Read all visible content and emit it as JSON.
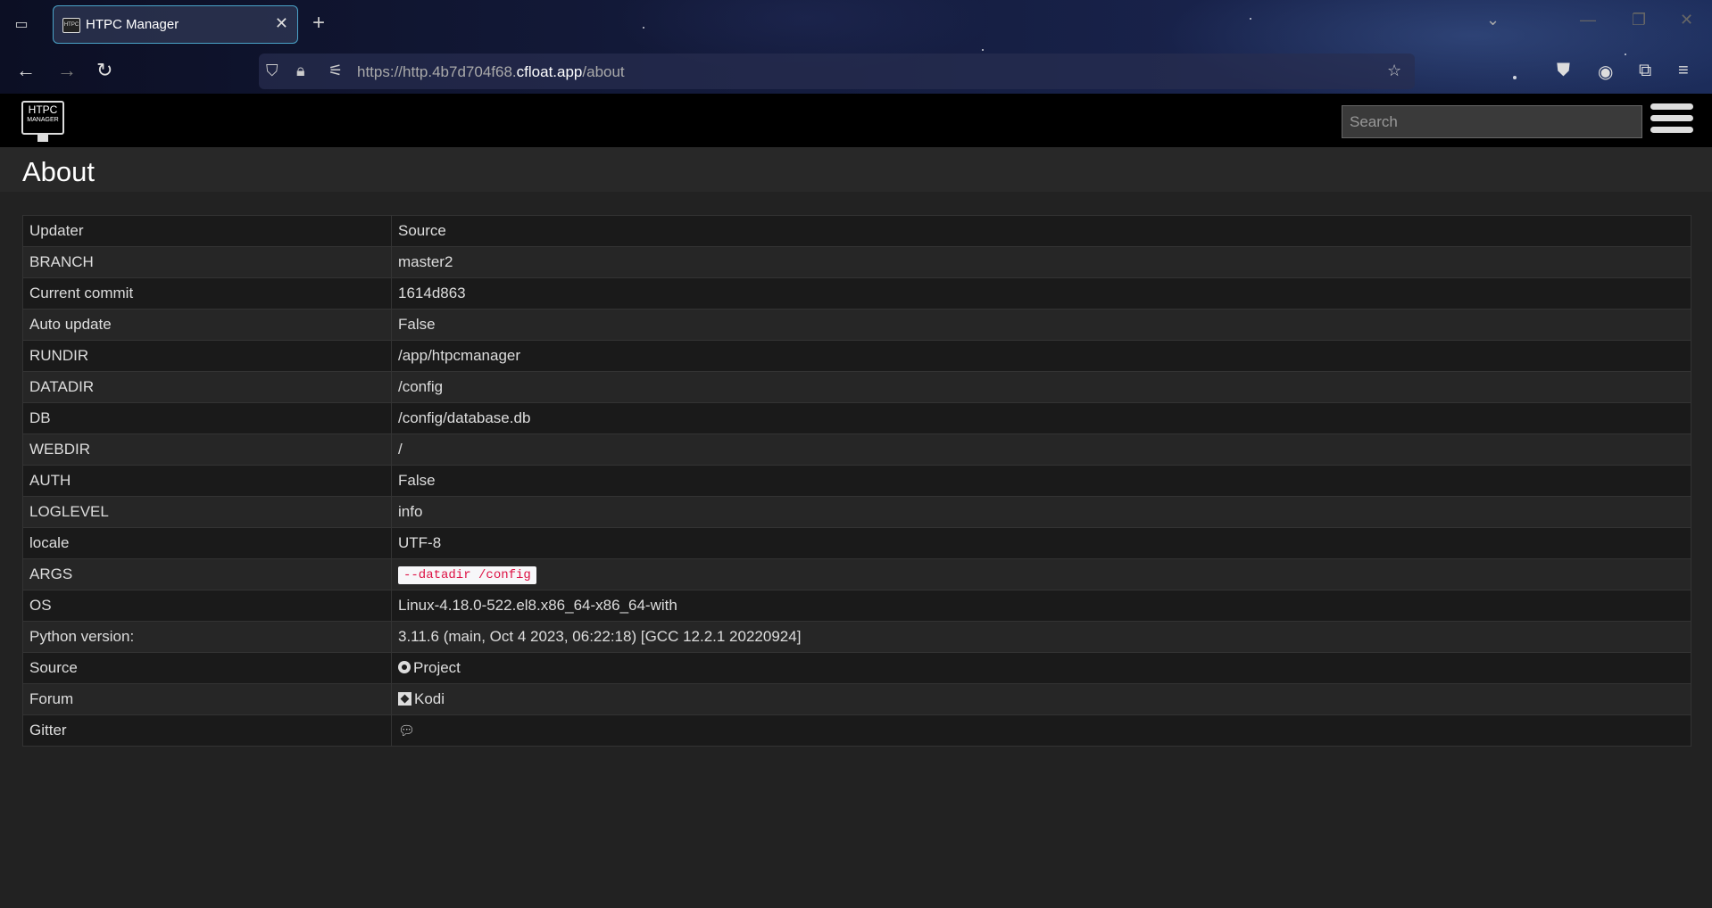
{
  "browser": {
    "tab_title": "HTPC Manager",
    "tab_close": "✕",
    "new_tab": "+",
    "url_prefix": "https://http.4b7d704f68.",
    "url_domain": "cfloat.app",
    "url_path": "/about",
    "icons": [
      "tab-list-icon",
      "back-icon",
      "forward-icon",
      "reload-icon",
      "shield-icon",
      "lock-icon",
      "permissions-icon",
      "star-icon",
      "pocket-icon",
      "account-icon",
      "extensions-icon",
      "menu-icon"
    ]
  },
  "navbar": {
    "logo_top": "HTPC",
    "logo_bottom": "MANAGER",
    "search_placeholder": "Search"
  },
  "page": {
    "title": "About"
  },
  "about_rows": [
    {
      "key": "Updater",
      "value": "Source"
    },
    {
      "key": "BRANCH",
      "value": "master2"
    },
    {
      "key": "Current commit",
      "value": "1614d863"
    },
    {
      "key": "Auto update",
      "value": "False"
    },
    {
      "key": "RUNDIR",
      "value": "/app/htpcmanager"
    },
    {
      "key": "DATADIR",
      "value": "/config"
    },
    {
      "key": "DB",
      "value": "/config/database.db"
    },
    {
      "key": "WEBDIR",
      "value": "/"
    },
    {
      "key": "AUTH",
      "value": "False"
    },
    {
      "key": "LOGLEVEL",
      "value": "info"
    },
    {
      "key": "locale",
      "value": "UTF-8"
    },
    {
      "key": "ARGS",
      "value": "--datadir /config"
    },
    {
      "key": "OS",
      "value": "Linux-4.18.0-522.el8.x86_64-x86_64-with"
    },
    {
      "key": "Python version:",
      "value": "3.11.6 (main, Oct 4 2023, 06:22:18) [GCC 12.2.1 20220924]"
    },
    {
      "key": "Source",
      "value": "Project"
    },
    {
      "key": "Forum",
      "value": "Kodi"
    },
    {
      "key": "Gitter",
      "value": ""
    }
  ]
}
